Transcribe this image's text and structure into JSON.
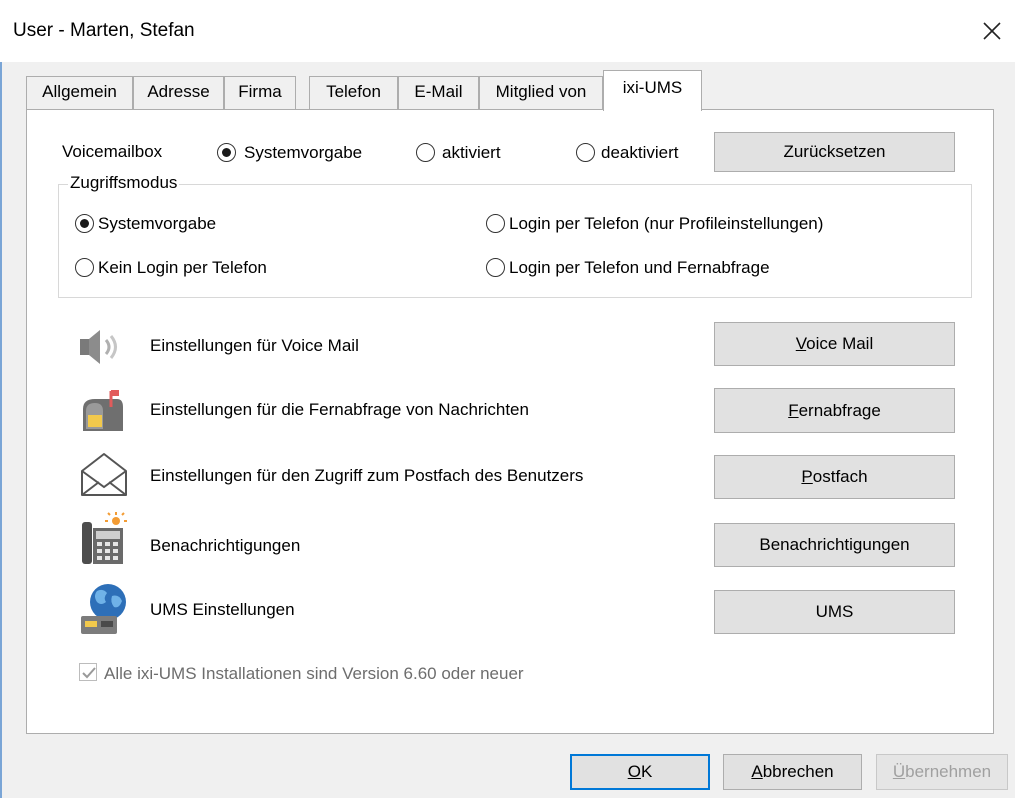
{
  "window": {
    "title": "User - Marten, Stefan"
  },
  "tabs": [
    {
      "label": "Allgemein",
      "active": false
    },
    {
      "label": "Adresse",
      "active": false
    },
    {
      "label": "Firma",
      "active": false
    },
    {
      "label": "Telefon",
      "active": false
    },
    {
      "label": "E-Mail",
      "active": false
    },
    {
      "label": "Mitglied von",
      "active": false
    },
    {
      "label": "ixi-UMS",
      "active": true
    }
  ],
  "voicemailbox": {
    "label": "Voicemailbox",
    "options": [
      "Systemvorgabe",
      "aktiviert",
      "deaktiviert"
    ],
    "selected": "Systemvorgabe",
    "reset_button": "Zurücksetzen"
  },
  "access_mode": {
    "legend": "Zugriffsmodus",
    "options": [
      "Systemvorgabe",
      "Login per Telefon (nur Profileinstellungen)",
      "Kein Login per Telefon",
      "Login per Telefon und Fernabfrage"
    ],
    "selected": "Systemvorgabe"
  },
  "settings": [
    {
      "icon": "speaker-icon",
      "description": "Einstellungen für Voice Mail",
      "button_label": "Voice Mail",
      "mnemonic": "V"
    },
    {
      "icon": "mailbox-icon",
      "description": "Einstellungen für die Fernabfrage von Nachrichten",
      "button_label": "Fernabfrage",
      "mnemonic": "F"
    },
    {
      "icon": "envelope-icon",
      "description": "Einstellungen für den Zugriff zum Postfach des Benutzers",
      "button_label": "Postfach",
      "mnemonic": "P"
    },
    {
      "icon": "phone-notification-icon",
      "description": "Benachrichtigungen",
      "button_label": "Benachrichtigungen",
      "mnemonic": ""
    },
    {
      "icon": "globe-server-icon",
      "description": "UMS Einstellungen",
      "button_label": "UMS",
      "mnemonic": ""
    }
  ],
  "version_check": {
    "label": "Alle ixi-UMS Installationen sind Version 6.60 oder neuer",
    "checked": true,
    "enabled": false
  },
  "footer": {
    "ok": "OK",
    "cancel": "Abbrechen",
    "apply": "Übernehmen"
  },
  "colors": {
    "accent": "#0078d7",
    "button_bg": "#e1e1e1",
    "window_bg": "#f0f0f0"
  }
}
